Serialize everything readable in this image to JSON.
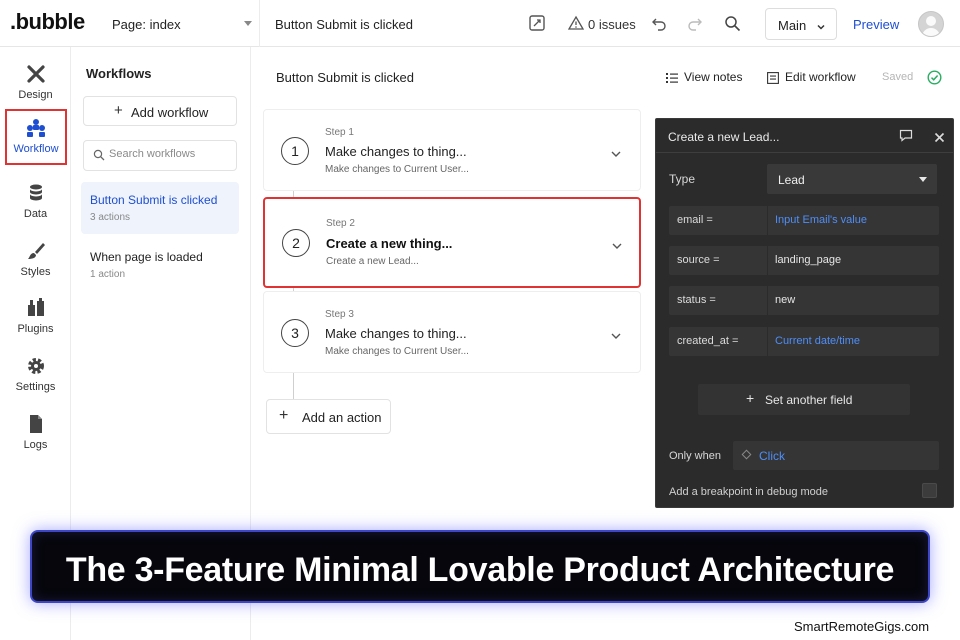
{
  "topbar": {
    "logo": ".bubble",
    "page_label": "Page: index",
    "workflow_title": "Button Submit is clicked",
    "issues": "0 issues",
    "branch": "Main",
    "preview": "Preview"
  },
  "rail": {
    "items": [
      {
        "label": "Design",
        "icon": "design-icon"
      },
      {
        "label": "Workflow",
        "icon": "workflow-icon",
        "active": true
      },
      {
        "label": "Data",
        "icon": "database-icon"
      },
      {
        "label": "Styles",
        "icon": "brush-icon"
      },
      {
        "label": "Plugins",
        "icon": "plugin-icon"
      },
      {
        "label": "Settings",
        "icon": "gear-icon"
      },
      {
        "label": "Logs",
        "icon": "document-icon"
      }
    ]
  },
  "workflows_panel": {
    "title": "Workflows",
    "add_label": "Add workflow",
    "search_placeholder": "Search workflows",
    "items": [
      {
        "name": "Button Submit is clicked",
        "count": "3 actions",
        "selected": true
      },
      {
        "name": "When page is loaded",
        "count": "1 action",
        "selected": false
      }
    ]
  },
  "center": {
    "title": "Button Submit is clicked",
    "view_notes": "View notes",
    "edit_workflow": "Edit workflow",
    "saved": "Saved",
    "steps": [
      {
        "number": "1",
        "label": "Step 1",
        "title": "Make changes to thing...",
        "subtitle": "Make changes to Current User..."
      },
      {
        "number": "2",
        "label": "Step 2",
        "title": "Create a new thing...",
        "subtitle": "Create a new Lead..."
      },
      {
        "number": "3",
        "label": "Step 3",
        "title": "Make changes to thing...",
        "subtitle": "Make changes to Current User..."
      }
    ],
    "add_action": "Add an action"
  },
  "editor": {
    "title": "Create a new Lead...",
    "type_label": "Type",
    "type_value": "Lead",
    "fields": [
      {
        "key": "email =",
        "value": "Input Email's value",
        "dynamic": true
      },
      {
        "key": "source =",
        "value": "landing_page",
        "dynamic": false
      },
      {
        "key": "status =",
        "value": "new",
        "dynamic": false
      },
      {
        "key": "created_at =",
        "value": "Current date/time",
        "dynamic": true
      }
    ],
    "set_another": "Set another field",
    "only_when_label": "Only when",
    "only_when_value": "Click",
    "breakpoint_label": "Add a breakpoint in debug mode"
  },
  "banner": {
    "text": "The 3-Feature Minimal Lovable Product Architecture"
  },
  "watermark": "SmartRemoteGigs.com",
  "colors": {
    "accent_blue": "#1f4fd1",
    "dynamic_blue": "#4f8ef7",
    "highlight_red": "#e03434",
    "panel_dark": "#2b2b2b",
    "saved_green": "#27ae60",
    "banner_glow": "#3d46c7"
  }
}
